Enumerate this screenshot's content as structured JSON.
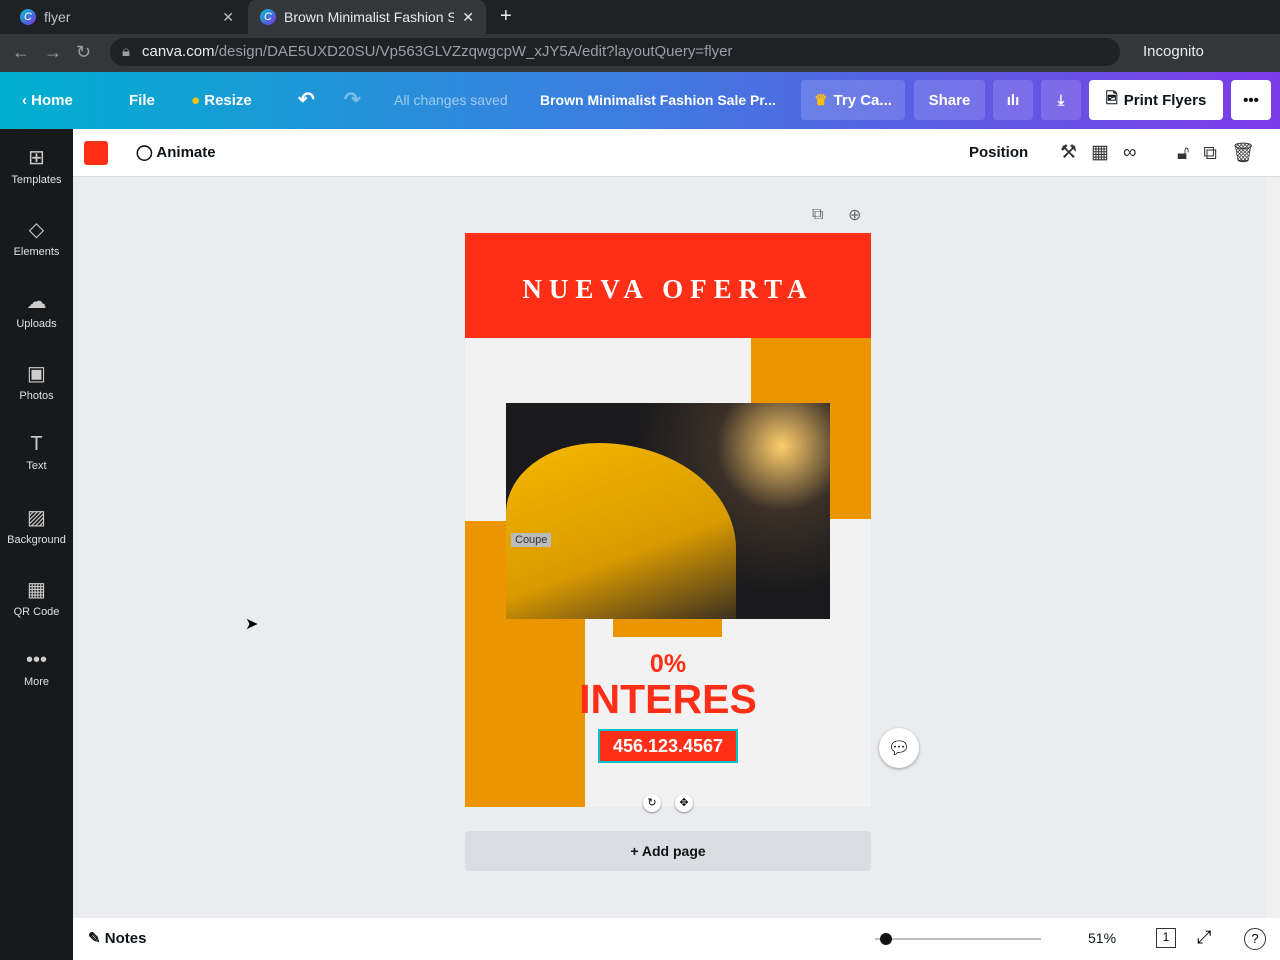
{
  "browser": {
    "tabs": [
      {
        "title": "flyer"
      },
      {
        "title": "Brown Minimalist Fashion S"
      }
    ],
    "url_domain": "canva.com",
    "url_path": "/design/DAE5UXD20SU/Vp563GLVZzqwgcpW_xJY5A/edit?layoutQuery=flyer",
    "profile": "Incognito"
  },
  "topbar": {
    "home": "Home",
    "file": "File",
    "resize": "Resize",
    "status": "All changes saved",
    "title": "Brown Minimalist Fashion Sale Pr...",
    "try": "Try Ca...",
    "share": "Share",
    "print": "Print Flyers"
  },
  "sidebar": {
    "items": [
      {
        "label": "Templates",
        "icon": "⊞"
      },
      {
        "label": "Elements",
        "icon": "◇"
      },
      {
        "label": "Uploads",
        "icon": "☁"
      },
      {
        "label": "Photos",
        "icon": "▣"
      },
      {
        "label": "Text",
        "icon": "T"
      },
      {
        "label": "Background",
        "icon": "▨"
      },
      {
        "label": "QR Code",
        "icon": "▦"
      },
      {
        "label": "More",
        "icon": "•••"
      }
    ]
  },
  "toolbar": {
    "animate": "Animate",
    "position": "Position",
    "color": "#ff2e17"
  },
  "design": {
    "heading": "NUEVA OFERTA",
    "percent": "0%",
    "interest": "INTERES",
    "phone": "456.123.4567",
    "photo_badge": "Coupe"
  },
  "add_page": "+ Add page",
  "bottom": {
    "notes": "Notes",
    "zoom": "51%",
    "page": "1"
  }
}
